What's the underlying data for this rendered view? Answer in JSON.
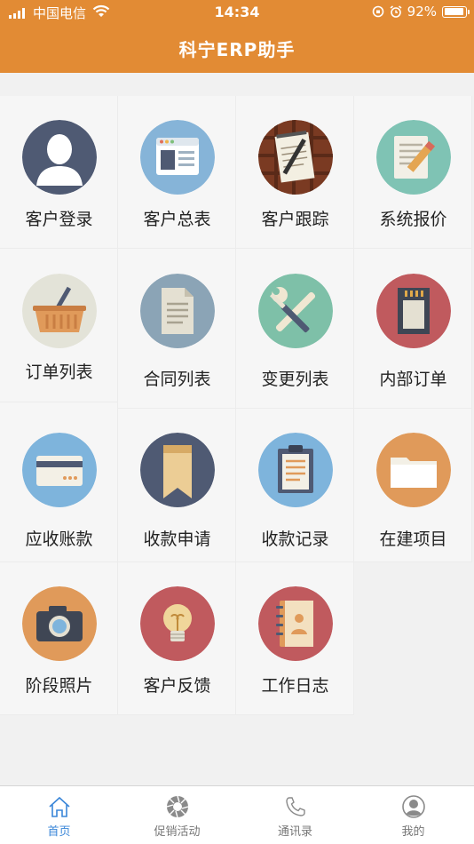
{
  "status": {
    "carrier": "中国电信",
    "time": "14:34",
    "battery": "92%",
    "battery_level": 0.92
  },
  "app": {
    "title": "科宁ERP助手"
  },
  "grid": {
    "items": [
      {
        "label": "客户登录",
        "icon": "user-avatar-icon",
        "color": "#4f5a73"
      },
      {
        "label": "客户总表",
        "icon": "browser-window-icon",
        "color": "#86b4d8"
      },
      {
        "label": "客户跟踪",
        "icon": "notepad-pen-icon",
        "color": "#7a3a22"
      },
      {
        "label": "系统报价",
        "icon": "document-pencil-icon",
        "color": "#7fc3b4"
      },
      {
        "label": "订单列表",
        "icon": "shopping-basket-icon",
        "color": "#e3e3d8"
      },
      {
        "label": "合同列表",
        "icon": "document-icon",
        "color": "#8ba4b6"
      },
      {
        "label": "变更列表",
        "icon": "wrench-screwdriver-icon",
        "color": "#7ec0a8"
      },
      {
        "label": "内部订单",
        "icon": "sd-card-icon",
        "color": "#c05a5e"
      },
      {
        "label": "应收账款",
        "icon": "credit-card-icon",
        "color": "#7eb4dc"
      },
      {
        "label": "收款申请",
        "icon": "bookmark-icon",
        "color": "#4f5a73"
      },
      {
        "label": "收款记录",
        "icon": "clipboard-icon",
        "color": "#7eb4dc"
      },
      {
        "label": "在建项目",
        "icon": "folder-icon",
        "color": "#e09a5a"
      },
      {
        "label": "阶段照片",
        "icon": "camera-icon",
        "color": "#e09a5a"
      },
      {
        "label": "客户反馈",
        "icon": "lightbulb-icon",
        "color": "#c05a5e"
      },
      {
        "label": "工作日志",
        "icon": "address-book-icon",
        "color": "#c05a5e"
      }
    ]
  },
  "tabs": [
    {
      "label": "首页",
      "icon": "home-icon",
      "active": true
    },
    {
      "label": "促销活动",
      "icon": "aperture-icon",
      "active": false
    },
    {
      "label": "通讯录",
      "icon": "phone-icon",
      "active": false
    },
    {
      "label": "我的",
      "icon": "profile-icon",
      "active": false
    }
  ],
  "colors": {
    "header": "#e28b34",
    "tab_active": "#3a86d8",
    "tab_inactive": "#777777"
  }
}
